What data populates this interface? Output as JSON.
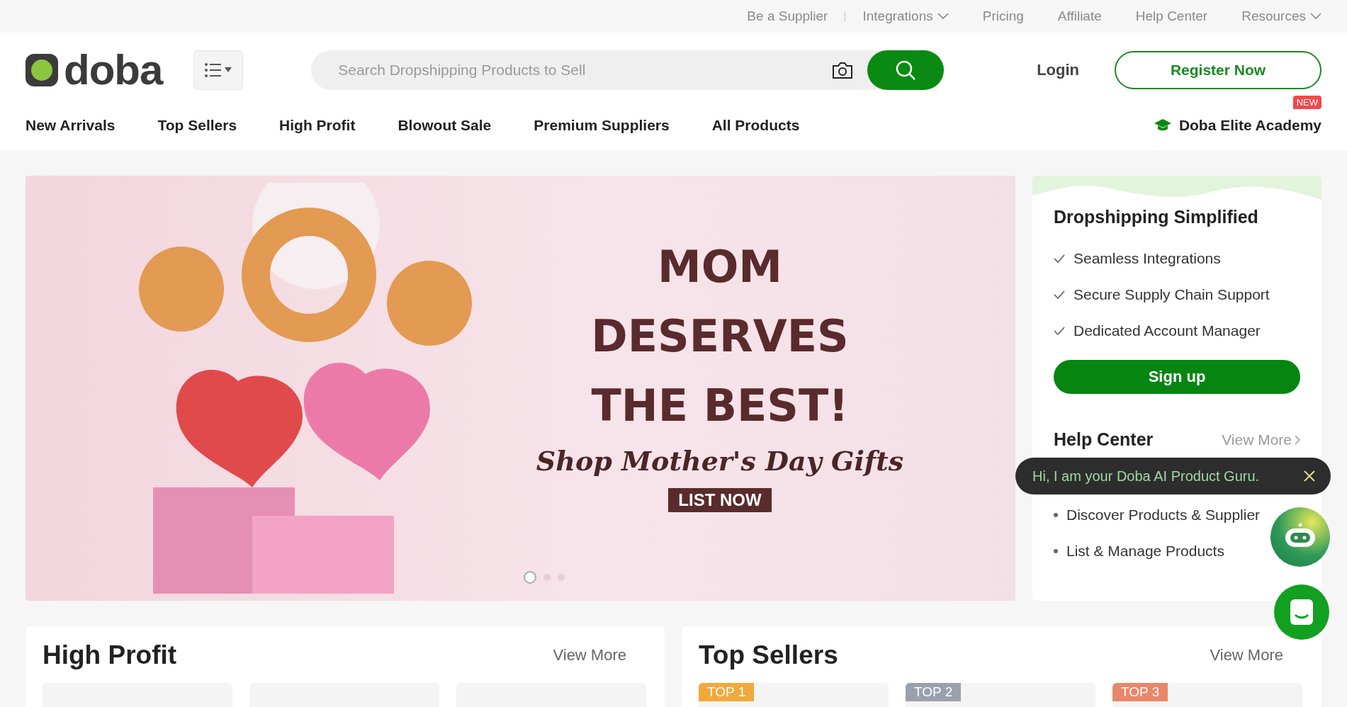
{
  "top_links": [
    {
      "label": "Be a Supplier",
      "kind": "link"
    },
    {
      "label": "Integrations",
      "kind": "dropdown"
    },
    {
      "label": "Pricing",
      "kind": "link"
    },
    {
      "label": "Affiliate",
      "kind": "link"
    },
    {
      "label": "Help Center",
      "kind": "link"
    },
    {
      "label": "Resources",
      "kind": "dropdown"
    }
  ],
  "header": {
    "logo": "doba",
    "search": {
      "placeholder": "Search Dropshipping Products to Sell"
    },
    "login": "Login",
    "register": "Register Now"
  },
  "nav": [
    "New Arrivals",
    "Top Sellers",
    "High Profit",
    "Blowout Sale",
    "Premium Suppliers",
    "All Products"
  ],
  "academy": {
    "label": "Doba Elite Academy",
    "badge": "NEW"
  },
  "banner": {
    "lines": [
      "MOM",
      "DESERVES",
      "THE BEST!"
    ],
    "script": "Shop Mother's Day Gifts",
    "cta": "LIST NOW",
    "dots": [
      {
        "selected": true
      },
      {
        "selected": false
      },
      {
        "selected": false
      }
    ]
  },
  "sidebar": {
    "title": "Dropshipping Simplified",
    "features": [
      "Seamless Integrations",
      "Secure Supply Chain Support",
      "Dedicated Account Manager"
    ],
    "signup": "Sign up",
    "help_title": "Help Center",
    "view_more": "View More",
    "help_items": [
      "Discover Products & Supplier",
      "List & Manage Products"
    ]
  },
  "tooltip": "Hi, I am your Doba AI Product Guru.",
  "sections": [
    {
      "title": "High Profit",
      "view_more": "View More",
      "cards": [
        {
          "kind": "plain"
        },
        {
          "kind": "plain"
        },
        {
          "kind": "plain"
        }
      ]
    },
    {
      "title": "Top Sellers",
      "view_more": "View More",
      "cards": [
        {
          "kind": "ranked",
          "badge": "TOP 1",
          "color": "#f0a93b"
        },
        {
          "kind": "ranked",
          "badge": "TOP 2",
          "color": "#9aa1ad"
        },
        {
          "kind": "ranked",
          "badge": "TOP 3",
          "color": "#e8876a"
        }
      ]
    }
  ]
}
